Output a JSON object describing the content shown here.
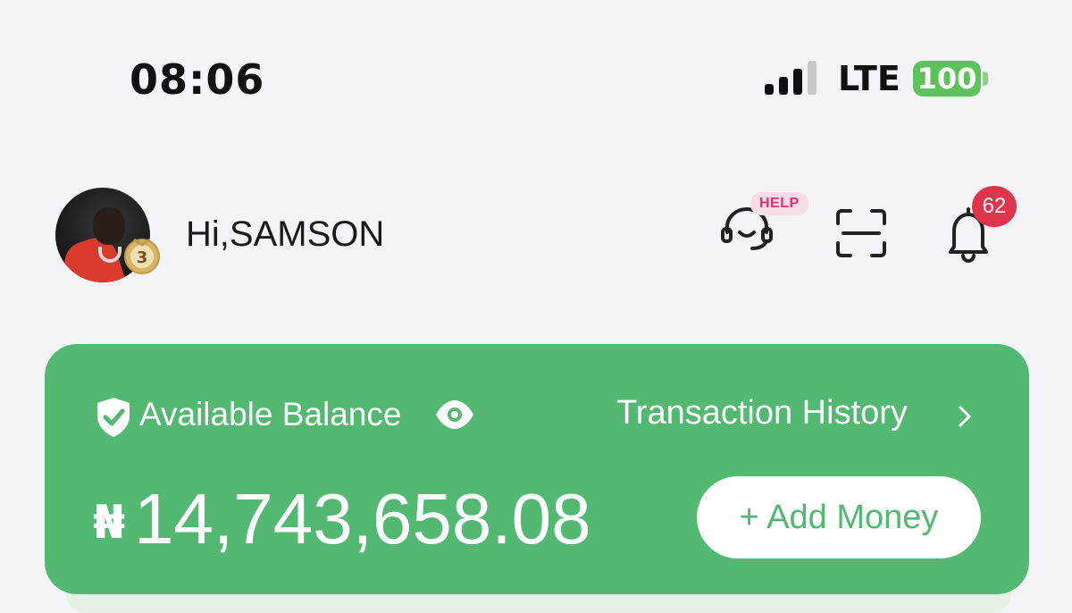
{
  "status_bar": {
    "time": "08:06",
    "network": "LTE",
    "battery": "100",
    "battery_color": "#5cc25a"
  },
  "header": {
    "greeting": "Hi,SAMSON",
    "medal_level": "3",
    "help_badge": "HELP",
    "notification_count": "62",
    "icons": [
      "customer-support-icon",
      "scan-icon",
      "bell-icon"
    ]
  },
  "balance_card": {
    "label": "Available Balance",
    "transaction_link": "Transaction History",
    "currency": "₦",
    "amount": "14,743,658.08",
    "add_money_label": "+ Add Money",
    "card_color": "#52b872"
  }
}
